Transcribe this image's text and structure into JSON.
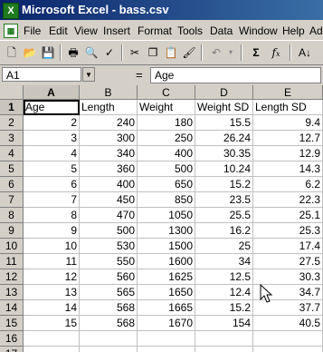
{
  "window": {
    "title": "Microsoft Excel - bass.csv",
    "app_icon_letter": "X"
  },
  "menu": [
    "File",
    "Edit",
    "View",
    "Insert",
    "Format",
    "Tools",
    "Data",
    "Window",
    "Help",
    "Ad"
  ],
  "formula_bar": {
    "name_box": "A1",
    "equals": "=",
    "content": "Age"
  },
  "toolbar_icons": [
    "new-icon",
    "open-icon",
    "save-icon",
    "print-icon",
    "print-preview-icon",
    "spelling-icon",
    "cut-icon",
    "copy-icon",
    "paste-icon",
    "format-painter-icon",
    "undo-icon",
    "autosum-icon",
    "function-icon"
  ],
  "sheet": {
    "columns": [
      "A",
      "B",
      "C",
      "D",
      "E"
    ],
    "rows": [
      "1",
      "2",
      "3",
      "4",
      "5",
      "6",
      "7",
      "8",
      "9",
      "10",
      "11",
      "12",
      "13",
      "14",
      "15",
      "16",
      "17"
    ],
    "header_row": [
      "Age",
      "Length",
      "Weight",
      "Weight SD",
      "Length SD"
    ],
    "data": [
      [
        "2",
        "240",
        "180",
        "15.5",
        "9.4"
      ],
      [
        "3",
        "300",
        "250",
        "26.24",
        "12.7"
      ],
      [
        "4",
        "340",
        "400",
        "30.35",
        "12.9"
      ],
      [
        "5",
        "360",
        "500",
        "10.24",
        "14.3"
      ],
      [
        "6",
        "400",
        "650",
        "15.2",
        "6.2"
      ],
      [
        "7",
        "450",
        "850",
        "23.5",
        "22.3"
      ],
      [
        "8",
        "470",
        "1050",
        "25.5",
        "25.1"
      ],
      [
        "9",
        "500",
        "1300",
        "16.2",
        "25.3"
      ],
      [
        "10",
        "530",
        "1500",
        "25",
        "17.4"
      ],
      [
        "11",
        "550",
        "1600",
        "34",
        "27.5"
      ],
      [
        "12",
        "560",
        "1625",
        "12.5",
        "30.3"
      ],
      [
        "13",
        "565",
        "1650",
        "12.4",
        "34.7"
      ],
      [
        "14",
        "568",
        "1665",
        "15.2",
        "37.7"
      ],
      [
        "15",
        "568",
        "1670",
        "154",
        "40.5"
      ]
    ]
  }
}
